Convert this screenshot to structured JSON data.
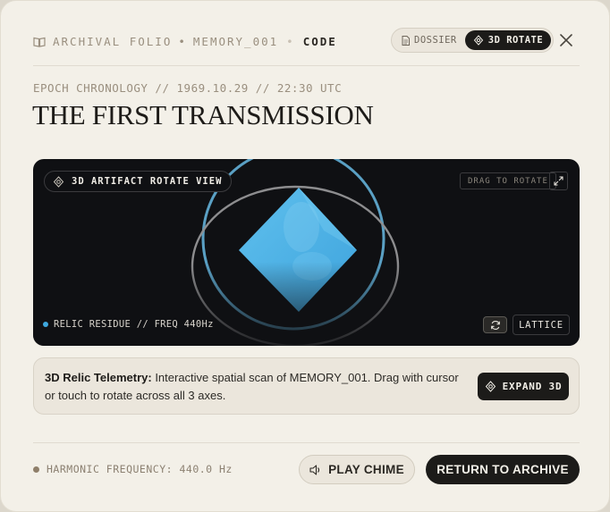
{
  "header": {
    "crumb_folio": "ARCHIVAL FOLIO",
    "crumb_sep": "•",
    "crumb_memory": "MEMORY_001",
    "crumb_sep2": "•",
    "crumb_code": "CODE",
    "toggle_dossier": "DOSSIER",
    "toggle_rotate": "3D ROTATE",
    "active_view": "3D ROTATE"
  },
  "epoch": "EPOCH CHRONOLOGY // 1969.10.29 // 22:30 UTC",
  "title": "THE FIRST TRANSMISSION",
  "viewer": {
    "label": "3D ARTIFACT ROTATE VIEW",
    "drag_hint": "DRAG TO ROTATE",
    "residue": "RELIC RESIDUE // FREQ 440Hz",
    "lattice_label": "LATTICE"
  },
  "telemetry": {
    "heading": "3D Relic Telemetry:",
    "body": " Interactive spatial scan of MEMORY_001. Drag with cursor or touch to rotate across all 3 axes.",
    "expand_label": "EXPAND 3D"
  },
  "footer": {
    "harmonic": "HARMONIC FREQUENCY: 440.0 Hz",
    "play_label": "PLAY CHIME",
    "return_label": "RETURN TO ARCHIVE"
  },
  "colors": {
    "accent_blue": "#4fb3e6",
    "ring_blue": "#5aa0c4",
    "dark": "#1c1b19",
    "paper": "#f3f0e8"
  },
  "icons": {
    "crumb": "book-open-icon",
    "dossier": "document-icon",
    "rotate": "rotate-3d-icon",
    "close": "close-icon",
    "expand": "expand-icon",
    "reset": "refresh-icon",
    "chime": "speaker-icon"
  }
}
